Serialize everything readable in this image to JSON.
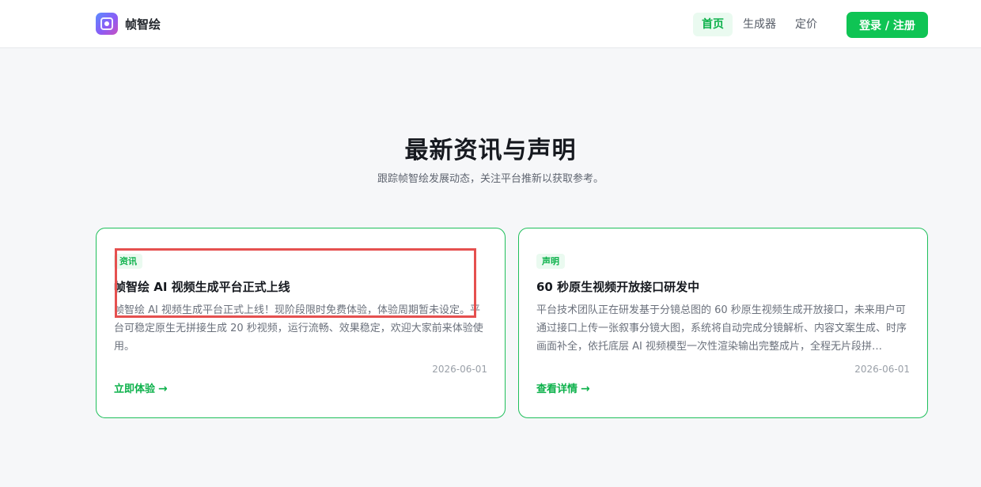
{
  "header": {
    "brand_name": "帧智绘",
    "nav": [
      "首页",
      "生成器",
      "定价"
    ],
    "login_label": "登录 / 注册"
  },
  "hero": {
    "title": "最新资讯与声明",
    "subtitle": "跟踪帧智绘发展动态，关注平台推新以获取参考。"
  },
  "cards": [
    {
      "tag": "资讯",
      "title": "帧智绘 AI 视频生成平台正式上线",
      "description": "帧智绘 AI 视频生成平台正式上线！现阶段限时免费体验，体验周期暂未设定。平台可稳定原生无拼接生成 20 秒视频，运行流畅、效果稳定，欢迎大家前来体验使用。",
      "date": "2026-06-01",
      "link": "立即体验"
    },
    {
      "tag": "声明",
      "title": "60 秒原生视频开放接口研发中",
      "description": "平台技术团队正在研发基于分镜总图的 60 秒原生视频生成开放接口，未来用户可通过接口上传一张叙事分镜大图，系统将自动完成分镜解析、内容文案生成、时序画面补全，依托底层 AI 视频模型一次性渲染输出完整成片，全程无片段拼…",
      "date": "2026-06-01",
      "link": "查看详情"
    }
  ],
  "colors": {
    "accent": "#0fc454",
    "highlight": "#e5504f"
  }
}
